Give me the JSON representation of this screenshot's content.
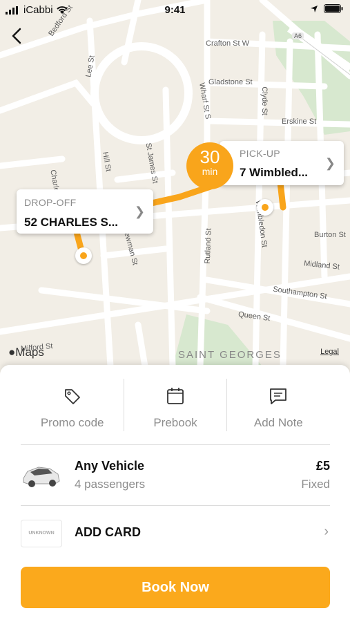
{
  "status_bar": {
    "carrier": "iCabbi",
    "time": "9:41"
  },
  "map": {
    "streets": [
      "Crafton St W",
      "Gladstone St",
      "Erskine St",
      "Burton St",
      "Midland St",
      "Southampton St",
      "Queen St",
      "Rutland St",
      "Wimbledon St",
      "Clyde St",
      "Wharf St S",
      "Lee St",
      "Hill St",
      "St James St",
      "Bedford St",
      "Charles St",
      "Newman St",
      "Milford St",
      "A6"
    ],
    "district": "SAINT GEORGES",
    "maps_label": "Maps",
    "legal_label": "Legal",
    "eta": {
      "value": "30",
      "unit": "min"
    },
    "pickup": {
      "label": "PICK-UP",
      "address": "7 Wimbled..."
    },
    "dropoff": {
      "label": "DROP-OFF",
      "address": "52 CHARLES S..."
    },
    "route_color": "#f9a51b"
  },
  "actions": [
    {
      "label": "Promo code",
      "icon": "tag-icon"
    },
    {
      "label": "Prebook",
      "icon": "calendar-icon"
    },
    {
      "label": "Add Note",
      "icon": "message-icon"
    }
  ],
  "vehicle": {
    "name": "Any Vehicle",
    "passengers": "4 passengers",
    "price": "£5",
    "price_type": "Fixed"
  },
  "payment": {
    "card_brand": "UNKNOWN",
    "label": "ADD CARD"
  },
  "book_button": {
    "label": "Book Now"
  },
  "colors": {
    "accent": "#fba91c"
  }
}
